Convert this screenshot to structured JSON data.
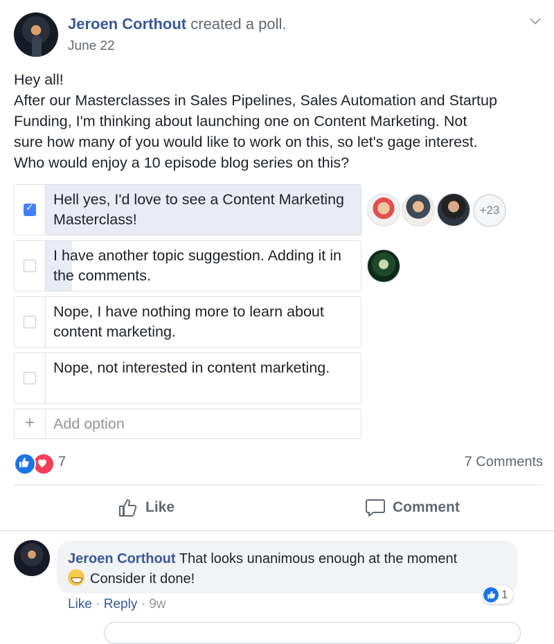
{
  "post": {
    "author": "Jeroen Corthout",
    "action": "created a poll.",
    "date": "June 22",
    "text_lines": [
      "Hey all!",
      "After our Masterclasses in Sales Pipelines, Sales Automation and Startup",
      "Funding, I'm thinking about launching one on Content Marketing. Not",
      "sure how many of you would like to work on this, so let's gage interest.",
      "Who would enjoy a 10 episode blog series on this?"
    ]
  },
  "poll": {
    "options": [
      {
        "label": "Hell yes, I'd love to see a Content Marketing Masterclass!",
        "checked": true,
        "voters_extra": "+23"
      },
      {
        "label": "I have another topic suggestion. Adding it in the comments.",
        "checked": false
      },
      {
        "label": "Nope, I have nothing more to learn about content marketing.",
        "checked": false
      },
      {
        "label": "Nope, not interested in content marketing.",
        "checked": false
      }
    ],
    "add_option": "Add option"
  },
  "reactions": {
    "count": "7",
    "comments": "7 Comments"
  },
  "actions": {
    "like": "Like",
    "comment": "Comment"
  },
  "comment": {
    "author": "Jeroen Corthout",
    "text1": "That looks unanimous enough at the moment",
    "text2": "Consider it done!",
    "like_count": "1",
    "like_link": "Like",
    "reply_link": "Reply",
    "time": "9w"
  },
  "colors": {
    "link_blue": "#385898",
    "checkbox_blue": "#4080ff",
    "like_blue": "#1b74e4",
    "love_red": "#f33e58"
  }
}
